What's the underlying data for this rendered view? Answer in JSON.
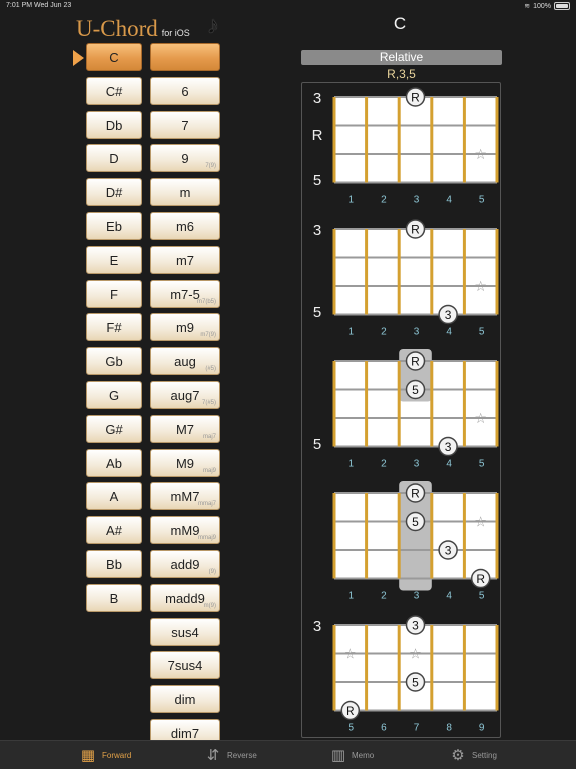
{
  "status": {
    "time": "7:01 PM",
    "date": "Wed Jun 23",
    "battery": "100%"
  },
  "logo": {
    "name": "U-Chord",
    "sub": "for iOS",
    "note": "♪"
  },
  "chord_title": "C",
  "relative_label": "Relative",
  "intervals": "R,3,5",
  "keys": [
    {
      "label": "C",
      "selected": true
    },
    {
      "label": "C#"
    },
    {
      "label": "Db"
    },
    {
      "label": "D"
    },
    {
      "label": "D#"
    },
    {
      "label": "Eb"
    },
    {
      "label": "E"
    },
    {
      "label": "F"
    },
    {
      "label": "F#"
    },
    {
      "label": "Gb"
    },
    {
      "label": "G"
    },
    {
      "label": "G#"
    },
    {
      "label": "Ab"
    },
    {
      "label": "A"
    },
    {
      "label": "A#"
    },
    {
      "label": "Bb"
    },
    {
      "label": "B"
    }
  ],
  "types": [
    {
      "label": "",
      "selected": true,
      "sub": ""
    },
    {
      "label": "6",
      "sub": ""
    },
    {
      "label": "7",
      "sub": ""
    },
    {
      "label": "9",
      "sub": "7(9)"
    },
    {
      "label": "m",
      "sub": ""
    },
    {
      "label": "m6",
      "sub": ""
    },
    {
      "label": "m7",
      "sub": ""
    },
    {
      "label": "m7-5",
      "sub": "m7(b5)"
    },
    {
      "label": "m9",
      "sub": "m7(9)"
    },
    {
      "label": "aug",
      "sub": "(#5)"
    },
    {
      "label": "aug7",
      "sub": "7(#5)"
    },
    {
      "label": "M7",
      "sub": "maj7"
    },
    {
      "label": "M9",
      "sub": "maj9"
    },
    {
      "label": "mM7",
      "sub": "mmaj7"
    },
    {
      "label": "mM9",
      "sub": "mmaj9"
    },
    {
      "label": "add9",
      "sub": "(9)"
    },
    {
      "label": "madd9",
      "sub": "m(9)"
    },
    {
      "label": "sus4",
      "sub": ""
    },
    {
      "label": "7sus4",
      "sub": ""
    },
    {
      "label": "dim",
      "sub": ""
    },
    {
      "label": "dim7",
      "sub": ""
    }
  ],
  "diagrams": [
    {
      "frets": [
        1,
        2,
        3,
        4,
        5
      ],
      "strings": [
        "3",
        "R",
        "5"
      ],
      "dots": [
        {
          "fret": 3,
          "string": 0,
          "label": "R"
        }
      ],
      "stars": [
        {
          "fret": 5,
          "string": 2
        }
      ],
      "highlight": null
    },
    {
      "frets": [
        1,
        2,
        3,
        4,
        5
      ],
      "strings": [
        "3",
        "",
        "5"
      ],
      "dots": [
        {
          "fret": 3,
          "string": 0,
          "label": "R"
        },
        {
          "fret": 4,
          "string": 3,
          "label": "3"
        }
      ],
      "stars": [
        {
          "fret": 5,
          "string": 2
        }
      ],
      "highlight": null
    },
    {
      "frets": [
        1,
        2,
        3,
        4,
        5
      ],
      "strings": [
        "",
        "",
        "5"
      ],
      "dots": [
        {
          "fret": 3,
          "string": 0,
          "label": "R"
        },
        {
          "fret": 3,
          "string": 1,
          "label": "5"
        },
        {
          "fret": 4,
          "string": 3,
          "label": "3"
        }
      ],
      "stars": [
        {
          "fret": 5,
          "string": 2
        }
      ],
      "highlight": {
        "fret": 3,
        "from": 0,
        "to": 1
      }
    },
    {
      "frets": [
        1,
        2,
        3,
        4,
        5
      ],
      "strings": [
        "",
        "",
        ""
      ],
      "dots": [
        {
          "fret": 3,
          "string": 0,
          "label": "R"
        },
        {
          "fret": 3,
          "string": 1,
          "label": "5"
        },
        {
          "fret": 4,
          "string": 2,
          "label": "3"
        },
        {
          "fret": 5,
          "string": 3,
          "label": "R"
        }
      ],
      "stars": [
        {
          "fret": 5,
          "string": 1
        }
      ],
      "highlight": {
        "fret": 3,
        "from": 0,
        "to": 3
      }
    },
    {
      "frets": [
        5,
        6,
        7,
        8,
        9
      ],
      "strings": [
        "3",
        "",
        ""
      ],
      "dots": [
        {
          "fret": 7,
          "string": 0,
          "label": "3"
        },
        {
          "fret": 7,
          "string": 2,
          "label": "5"
        },
        {
          "fret": 5,
          "string": 3,
          "label": "R"
        }
      ],
      "stars": [
        {
          "fret": 5,
          "string": 1
        },
        {
          "fret": 7,
          "string": 1
        }
      ],
      "highlight": null
    }
  ],
  "tabs": [
    {
      "label": "Forward",
      "icon": "fretboard-icon",
      "active": true
    },
    {
      "label": "Reverse",
      "icon": "reverse-icon"
    },
    {
      "label": "Memo",
      "icon": "memo-icon"
    },
    {
      "label": "Setting",
      "icon": "gear-icon"
    }
  ],
  "colors": {
    "accent": "#e59a4c",
    "fret": "#d4a030",
    "bg": "#1c1c1c",
    "fret_number": "#8ec7d6"
  }
}
